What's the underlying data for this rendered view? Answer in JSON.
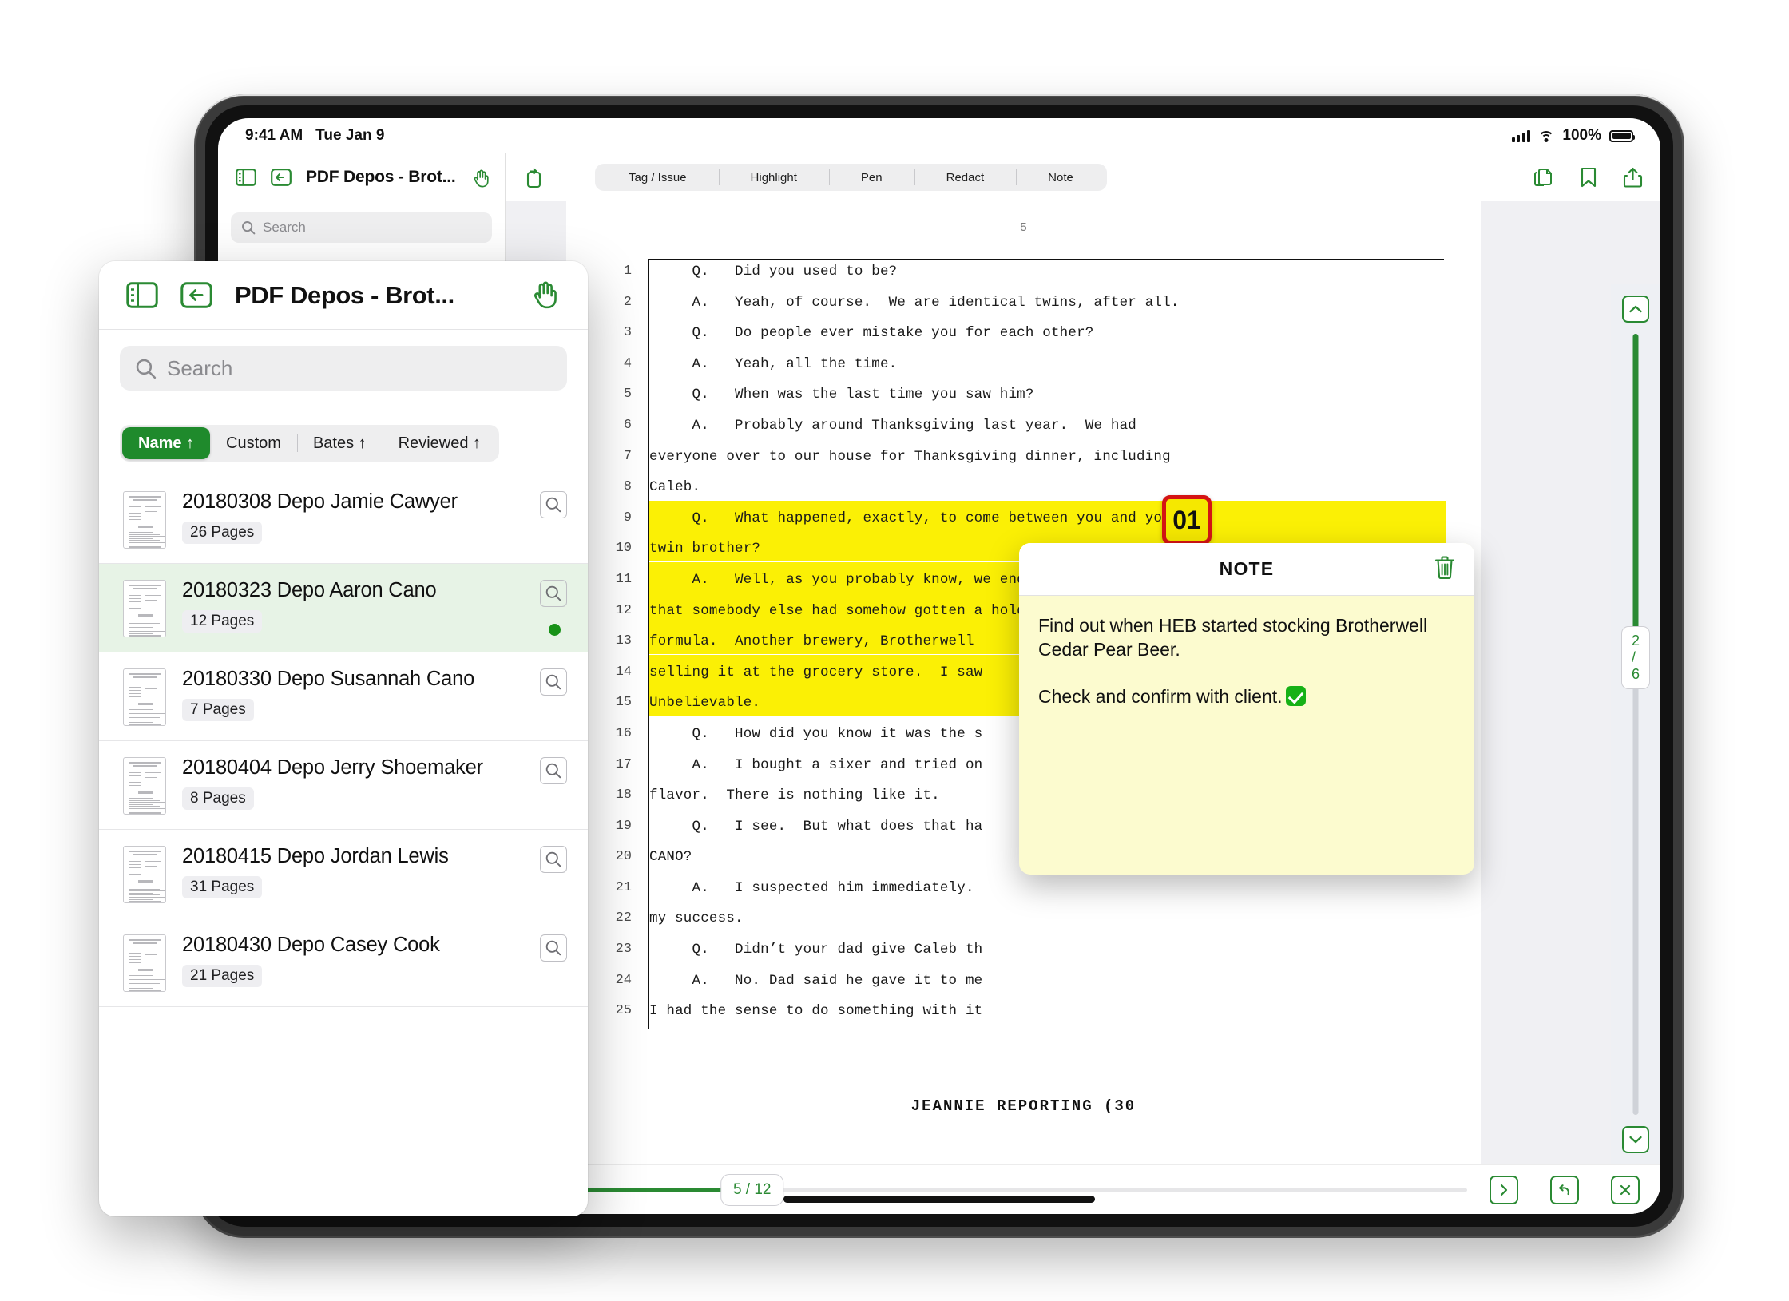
{
  "status_bar": {
    "time": "9:41 AM",
    "date": "Tue Jan 9",
    "battery_pct": "100%",
    "signal_icon": "cellular-signal-icon",
    "wifi_icon": "wifi-icon",
    "battery_icon": "battery-icon"
  },
  "nav": {
    "sidebar_toggle_icon": "sidebar-toggle-icon",
    "back_icon": "back-arrow-icon",
    "title": "PDF Depos - Brot...",
    "hand_tool_icon": "hand-tool-icon",
    "rotate_icon": "rotate-page-icon",
    "copy_pages_icon": "copy-pages-icon",
    "bookmark_icon": "bookmark-icon",
    "share_icon": "share-icon"
  },
  "toolbar": {
    "items": [
      {
        "label": "Tag / Issue"
      },
      {
        "label": "Highlight"
      },
      {
        "label": "Pen"
      },
      {
        "label": "Redact"
      },
      {
        "label": "Note"
      }
    ]
  },
  "sidebar": {
    "search_placeholder": "Search",
    "search_icon": "search-icon"
  },
  "files_panel": {
    "sidebar_toggle_icon": "sidebar-toggle-icon",
    "back_icon": "back-arrow-icon",
    "title": "PDF Depos - Brot...",
    "hand_tool_icon": "hand-tool-icon",
    "search_placeholder": "Search",
    "search_icon": "search-icon",
    "sort_options": [
      {
        "label": "Name ↑",
        "active": true
      },
      {
        "label": "Custom",
        "active": false
      },
      {
        "label": "Bates ↑",
        "active": false
      },
      {
        "label": "Reviewed ↑",
        "active": false
      }
    ],
    "files": [
      {
        "name": "20180308 Depo Jamie Cawyer",
        "pages": "26 Pages",
        "selected": false,
        "dot": false
      },
      {
        "name": "20180323 Depo Aaron Cano",
        "pages": "12 Pages",
        "selected": true,
        "dot": true
      },
      {
        "name": "20180330 Depo Susannah Cano",
        "pages": "7 Pages",
        "selected": false,
        "dot": false
      },
      {
        "name": "20180404 Depo Jerry Shoemaker",
        "pages": "8 Pages",
        "selected": false,
        "dot": false
      },
      {
        "name": "20180415 Depo Jordan Lewis",
        "pages": "31 Pages",
        "selected": false,
        "dot": false
      },
      {
        "name": "20180430 Depo Casey Cook",
        "pages": "21 Pages",
        "selected": false,
        "dot": false
      }
    ],
    "magnify_icon": "magnify-icon",
    "status_dot_color": "#189218"
  },
  "document": {
    "page_number_label": "5",
    "footer": "JEANNIE REPORTING (30",
    "lines": [
      {
        "n": "1",
        "text": "     Q.   Did you used to be?",
        "highlight": false
      },
      {
        "n": "2",
        "text": "     A.   Yeah, of course.  We are identical twins, after all.",
        "highlight": false
      },
      {
        "n": "3",
        "text": "     Q.   Do people ever mistake you for each other?",
        "highlight": false
      },
      {
        "n": "4",
        "text": "     A.   Yeah, all the time.",
        "highlight": false
      },
      {
        "n": "5",
        "text": "     Q.   When was the last time you saw him?",
        "highlight": false
      },
      {
        "n": "6",
        "text": "     A.   Probably around Thanksgiving last year.  We had",
        "highlight": false
      },
      {
        "n": "7",
        "text": "everyone over to our house for Thanksgiving dinner, including",
        "highlight": false
      },
      {
        "n": "8",
        "text": "Caleb.",
        "highlight": false
      },
      {
        "n": "9",
        "text": "     Q.   What happened, exactly, to come between you and your",
        "highlight": true
      },
      {
        "n": "10",
        "text": "twin brother?",
        "highlight": true
      },
      {
        "n": "11",
        "text": "     A.   Well, as you probably know, we ended up finding out",
        "highlight": true
      },
      {
        "n": "12",
        "text": "that somebody else had somehow gotten a hold of my dad’s beer",
        "highlight": true
      },
      {
        "n": "13",
        "text": "formula.  Another brewery, Brotherwell ",
        "highlight": true
      },
      {
        "n": "14",
        "text": "selling it at the grocery store.  I saw",
        "highlight": true
      },
      {
        "n": "15",
        "text": "Unbelievable.",
        "highlight": true
      },
      {
        "n": "16",
        "text": "     Q.   How did you know it was the s",
        "highlight": false
      },
      {
        "n": "17",
        "text": "     A.   I bought a sixer and tried on",
        "highlight": false
      },
      {
        "n": "18",
        "text": "flavor.  There is nothing like it.",
        "highlight": false
      },
      {
        "n": "19",
        "text": "     Q.   I see.  But what does that ha",
        "highlight": false
      },
      {
        "n": "20",
        "text": "CANO?",
        "highlight": false
      },
      {
        "n": "21",
        "text": "     A.   I suspected him immediately.",
        "highlight": false
      },
      {
        "n": "22",
        "text": "my success.",
        "highlight": false
      },
      {
        "n": "23",
        "text": "     Q.   Didn’t your dad give Caleb th",
        "highlight": false
      },
      {
        "n": "24",
        "text": "     A.   No. Dad said he gave it to me",
        "highlight": false
      },
      {
        "n": "25",
        "text": "I had the sense to do something with it",
        "highlight": false
      }
    ]
  },
  "note_marker": {
    "label": "01",
    "fill": "#f5e800",
    "border": "#d41414"
  },
  "note_popup": {
    "title": "NOTE",
    "delete_icon": "trash-icon",
    "paragraphs": [
      "Find out when HEB started stocking Brotherwell Cedar Pear Beer.",
      "Check and confirm with client."
    ],
    "check_icon": "check-mark-icon"
  },
  "scroll_rail": {
    "up_icon": "chevron-up-icon",
    "down_icon": "chevron-down-icon",
    "badge": "2 / 6"
  },
  "bottom_bar": {
    "page_badge": "5 / 12",
    "next_icon": "chevron-right-icon",
    "undo_icon": "undo-icon",
    "close_icon": "close-icon"
  },
  "accent_color": "#2a8a33",
  "highlight_color": "#fbf005"
}
